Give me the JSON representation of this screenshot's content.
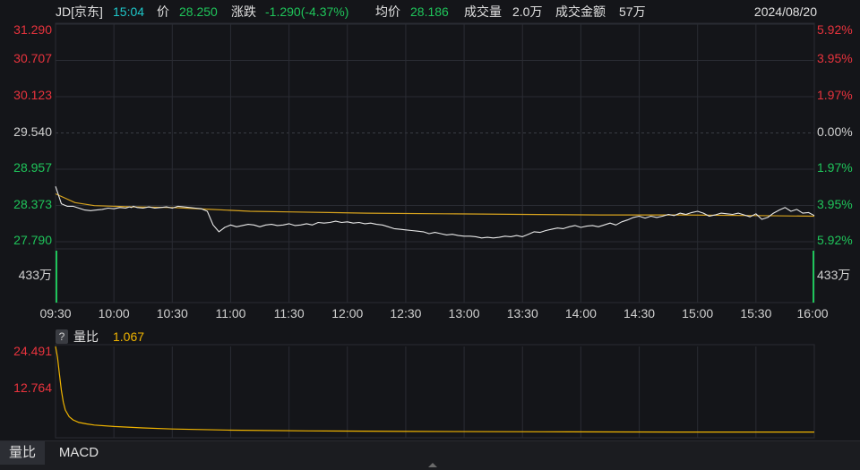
{
  "header": {
    "stock": "JD[京东]",
    "time": "15:04",
    "price_label": "价",
    "price": "28.250",
    "change_label": "涨跌",
    "change": "-1.290(-4.37%)",
    "avg_label": "均价",
    "avg": "28.186",
    "volume_label": "成交量",
    "volume": "2.0万",
    "turnover_label": "成交金额",
    "turnover": "57万",
    "date": "2024/08/20"
  },
  "sub_panel": {
    "help": "?",
    "name": "量比",
    "value": "1.067"
  },
  "tabs": [
    "量比",
    "MACD"
  ],
  "colors": {
    "background": "#141519",
    "price_line": "#e8e8e8",
    "avg_line": "#d6a21e",
    "up": "#e8333d",
    "down": "#1fc45a",
    "grid": "#2a2c33",
    "volume_ratio_line": "#f0b400"
  },
  "chart_data": [
    {
      "type": "line",
      "title": "",
      "x_ticks": [
        "09:30",
        "10:00",
        "10:30",
        "11:00",
        "11:30",
        "12:00",
        "12:30",
        "13:00",
        "13:30",
        "14:00",
        "14:30",
        "15:00",
        "15:30",
        "16:00"
      ],
      "y_ticks_left": [
        {
          "label": "31.290",
          "value": 31.29,
          "color": "up"
        },
        {
          "label": "30.707",
          "value": 30.707,
          "color": "up"
        },
        {
          "label": "30.123",
          "value": 30.123,
          "color": "up"
        },
        {
          "label": "29.540",
          "value": 29.54,
          "color": "flat"
        },
        {
          "label": "28.957",
          "value": 28.957,
          "color": "down"
        },
        {
          "label": "28.373",
          "value": 28.373,
          "color": "down"
        },
        {
          "label": "27.790",
          "value": 27.79,
          "color": "down"
        }
      ],
      "y_ticks_right": [
        {
          "label": "5.92%",
          "color": "up"
        },
        {
          "label": "3.95%",
          "color": "up"
        },
        {
          "label": "1.97%",
          "color": "up"
        },
        {
          "label": "0.00%",
          "color": "flat"
        },
        {
          "label": "1.97%",
          "color": "down"
        },
        {
          "label": "3.95%",
          "color": "down"
        },
        {
          "label": "5.92%",
          "color": "down"
        }
      ],
      "volume_label": "433万",
      "ylim": [
        27.79,
        31.29
      ],
      "prev_close": 29.54,
      "grid": true,
      "series": [
        {
          "key": "price",
          "x": [
            0,
            3,
            6,
            9,
            12,
            15,
            18,
            21,
            24,
            27,
            30,
            33,
            36,
            38,
            39,
            40,
            42,
            45,
            48,
            51,
            54,
            57,
            60,
            63,
            66,
            69,
            72,
            75,
            78,
            81,
            84,
            87,
            90,
            93,
            96,
            99,
            102,
            105,
            108,
            111,
            114,
            117,
            120,
            123,
            126,
            129,
            132,
            135,
            138,
            141,
            144,
            147,
            150,
            153,
            156,
            159,
            162,
            165,
            168,
            171,
            174,
            177,
            180,
            183,
            186,
            189,
            192,
            195,
            198,
            201,
            204,
            207,
            210,
            213,
            216,
            219,
            222,
            225,
            228,
            231,
            234,
            237,
            240,
            243,
            246,
            249,
            252,
            255,
            258,
            261,
            264,
            267,
            270,
            273,
            276,
            279,
            282,
            285,
            288,
            291,
            294,
            297,
            300,
            303,
            306,
            309,
            312,
            315,
            318,
            321,
            324,
            327,
            330,
            333,
            336,
            339,
            342,
            345,
            348,
            351,
            354,
            357,
            360,
            363,
            366,
            369,
            372,
            375,
            378,
            381,
            384,
            387,
            390
          ],
          "values": [
            28.68,
            28.4,
            28.36,
            28.36,
            28.33,
            28.3,
            28.29,
            28.3,
            28.31,
            28.33,
            28.32,
            28.34,
            28.33,
            28.35,
            28.34,
            28.36,
            28.34,
            28.33,
            28.35,
            28.33,
            28.34,
            28.35,
            28.33,
            28.36,
            28.35,
            28.34,
            28.33,
            28.32,
            28.28,
            28.06,
            27.95,
            28.02,
            28.06,
            28.03,
            28.05,
            28.07,
            28.06,
            28.03,
            28.06,
            28.07,
            28.05,
            28.06,
            28.08,
            28.05,
            28.06,
            28.08,
            28.06,
            28.1,
            28.09,
            28.1,
            28.12,
            28.1,
            28.11,
            28.09,
            28.1,
            28.08,
            28.09,
            28.07,
            28.06,
            28.03,
            28.0,
            27.99,
            27.98,
            27.97,
            27.96,
            27.95,
            27.92,
            27.94,
            27.92,
            27.9,
            27.91,
            27.89,
            27.88,
            27.88,
            27.87,
            27.85,
            27.86,
            27.85,
            27.86,
            27.88,
            27.87,
            27.89,
            27.87,
            27.91,
            27.95,
            27.94,
            27.97,
            27.99,
            28.01,
            28.0,
            28.03,
            28.05,
            28.02,
            28.04,
            28.05,
            28.03,
            28.06,
            28.09,
            28.06,
            28.11,
            28.14,
            28.18,
            28.2,
            28.17,
            28.2,
            28.18,
            28.2,
            28.23,
            28.21,
            28.25,
            28.23,
            28.26,
            28.28,
            28.25,
            28.2,
            28.22,
            28.25,
            28.24,
            28.23,
            28.25,
            28.22,
            28.19,
            28.24,
            28.15,
            28.18,
            28.25,
            28.3,
            28.34,
            28.28,
            28.31,
            28.25,
            28.26,
            28.21
          ]
        },
        {
          "key": "avg",
          "x": [
            0,
            10,
            20,
            40,
            60,
            80,
            100,
            120,
            160,
            200,
            240,
            280,
            320,
            360,
            390
          ],
          "values": [
            28.56,
            28.42,
            28.37,
            28.35,
            28.34,
            28.31,
            28.28,
            28.27,
            28.25,
            28.24,
            28.23,
            28.22,
            28.22,
            28.21,
            28.2
          ]
        }
      ]
    },
    {
      "type": "line",
      "title": "",
      "y_ticks": [
        {
          "label": "24.491",
          "value": 24.491
        },
        {
          "label": "12.764",
          "value": 12.764
        }
      ],
      "ylim": [
        0,
        24.491
      ],
      "series": [
        {
          "key": "volume_ratio",
          "x": [
            0,
            1,
            2,
            3,
            4,
            5,
            7,
            9,
            12,
            16,
            20,
            30,
            45,
            60,
            90,
            130,
            180,
            250,
            320,
            390
          ],
          "values": [
            24.491,
            21.5,
            17.0,
            12.5,
            9.2,
            7.1,
            5.3,
            4.4,
            3.7,
            3.3,
            3.0,
            2.6,
            2.2,
            1.9,
            1.6,
            1.4,
            1.25,
            1.15,
            1.08,
            1.067
          ]
        }
      ]
    }
  ]
}
